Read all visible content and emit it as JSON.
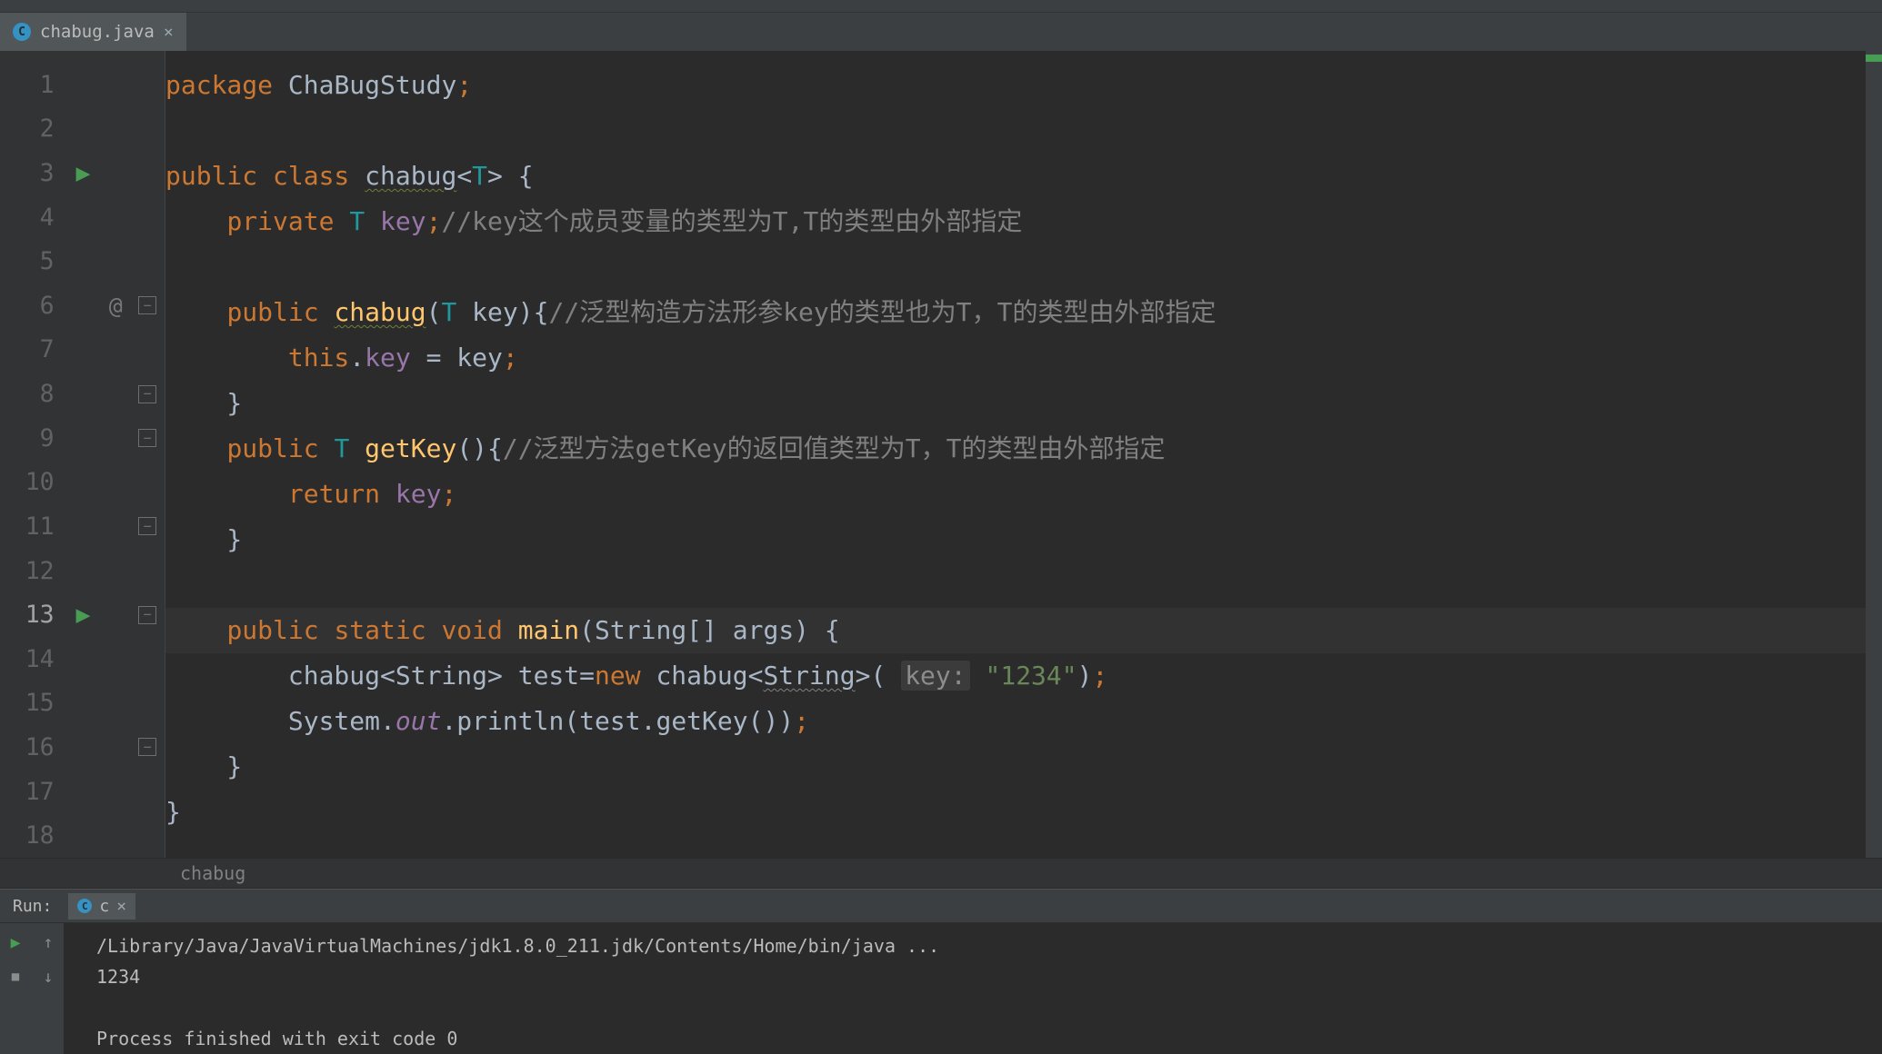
{
  "tab": {
    "filename": "chabug.java",
    "icon_letter": "C"
  },
  "code": {
    "lines": [
      {
        "n": "1",
        "run": "",
        "ann": "",
        "fold": "",
        "html": "<span class='kw'>package</span> ChaBugStudy<span class='kw'>;</span>"
      },
      {
        "n": "2",
        "run": "",
        "ann": "",
        "fold": "",
        "html": ""
      },
      {
        "n": "3",
        "run": "▶",
        "ann": "",
        "fold": "",
        "html": "<span class='kw'>public class</span> <span class='wavy-olive'>chabug</span>&lt;<span class='typeparam'>T</span>&gt; {"
      },
      {
        "n": "4",
        "run": "",
        "ann": "",
        "fold": "",
        "html": "    <span class='kw'>private</span> <span class='typeparam'>T</span> <span class='purple'>key</span><span class='kw'>;</span><span class='comment'>//key这个成员变量的类型为T,T的类型由外部指定</span>"
      },
      {
        "n": "5",
        "run": "",
        "ann": "",
        "fold": "",
        "html": ""
      },
      {
        "n": "6",
        "run": "",
        "ann": "@",
        "fold": "⊟",
        "html": "    <span class='kw'>public</span> <span class='id-dec wavy-olive'>chabug</span>(<span class='typeparam'>T</span> key){<span class='comment'>//泛型构造方法形参key的类型也为T，T的类型由外部指定</span>"
      },
      {
        "n": "7",
        "run": "",
        "ann": "",
        "fold": "",
        "html": "        <span class='kw'>this</span>.<span class='purple'>key</span> = key<span class='kw'>;</span>"
      },
      {
        "n": "8",
        "run": "",
        "ann": "",
        "fold": "⊟",
        "html": "    }"
      },
      {
        "n": "9",
        "run": "",
        "ann": "",
        "fold": "⊟",
        "html": "    <span class='kw'>public</span> <span class='typeparam'>T</span> <span class='id-dec'>getKey</span>(){<span class='comment'>//泛型方法getKey的返回值类型为T，T的类型由外部指定</span>"
      },
      {
        "n": "10",
        "run": "",
        "ann": "",
        "fold": "",
        "html": "        <span class='kw'>return</span> <span class='purple'>key</span><span class='kw'>;</span>"
      },
      {
        "n": "11",
        "run": "",
        "ann": "",
        "fold": "⊟",
        "html": "    }"
      },
      {
        "n": "12",
        "run": "",
        "ann": "",
        "fold": "",
        "html": ""
      },
      {
        "n": "13",
        "run": "▶",
        "ann": "",
        "fold": "⊟",
        "html": "    <span class='kw'>public static void</span> <span class='id-dec'>main</span>(String[] args) {",
        "current": true
      },
      {
        "n": "14",
        "run": "",
        "ann": "",
        "fold": "",
        "html": "        chabug&lt;String&gt; test=<span class='kw'>new</span> chabug&lt;<span class='wavy'>String</span>&gt;( <span class='hint-box'>key:</span> <span class='literal'>\"1234\"</span>)<span class='kw'>;</span>"
      },
      {
        "n": "15",
        "run": "",
        "ann": "",
        "fold": "",
        "html": "        System.<span class='purple' style='font-style:italic'>out</span>.println(test.getKey())<span class='kw'>;</span>"
      },
      {
        "n": "16",
        "run": "",
        "ann": "",
        "fold": "⊟",
        "html": "    }"
      },
      {
        "n": "17",
        "run": "",
        "ann": "",
        "fold": "",
        "html": "}"
      },
      {
        "n": "18",
        "run": "",
        "ann": "",
        "fold": "",
        "html": ""
      }
    ]
  },
  "breadcrumb": "chabug",
  "run_panel": {
    "label": "Run:",
    "config_name": "c",
    "output_lines": [
      "/Library/Java/JavaVirtualMachines/jdk1.8.0_211.jdk/Contents/Home/bin/java ...",
      "1234",
      "",
      "Process finished with exit code 0"
    ]
  }
}
